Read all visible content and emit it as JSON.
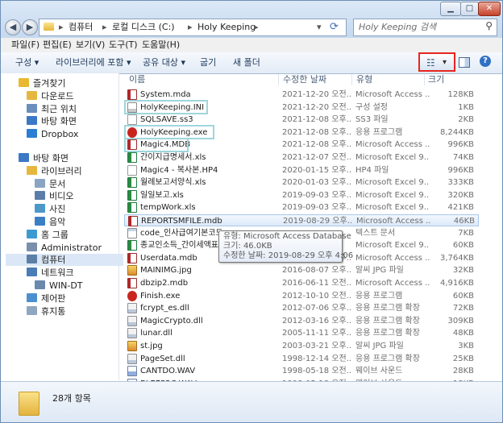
{
  "address": {
    "segments": [
      "컴퓨터",
      "로컬 디스크 (C:)",
      "Holy Keeping"
    ]
  },
  "search": {
    "placeholder": "Holy Keeping 검색"
  },
  "menu": [
    "파일(F)",
    "편집(E)",
    "보기(V)",
    "도구(T)",
    "도움말(H)"
  ],
  "commands": {
    "organize": "구성",
    "include_library": "라이브러리에 포함",
    "share": "공유 대상",
    "burn": "굽기",
    "new_folder": "새 폴더"
  },
  "sidebar": [
    {
      "label": "즐겨찾기",
      "icon": "star-icon",
      "indent": 0
    },
    {
      "label": "다운로드",
      "icon": "download-folder-icon",
      "indent": 1
    },
    {
      "label": "최근 위치",
      "icon": "recent-places-icon",
      "indent": 1
    },
    {
      "label": "바탕 화면",
      "icon": "desktop-icon",
      "indent": 1
    },
    {
      "label": "Dropbox",
      "icon": "dropbox-icon",
      "indent": 1
    },
    {
      "label": "바탕 화면",
      "icon": "desktop-icon",
      "indent": 0,
      "gap": true
    },
    {
      "label": "라이브러리",
      "icon": "library-icon",
      "indent": 1
    },
    {
      "label": "문서",
      "icon": "documents-icon",
      "indent": 2
    },
    {
      "label": "비디오",
      "icon": "video-icon",
      "indent": 2
    },
    {
      "label": "사진",
      "icon": "pictures-icon",
      "indent": 2
    },
    {
      "label": "음악",
      "icon": "music-icon",
      "indent": 2
    },
    {
      "label": "홈 그룹",
      "icon": "homegroup-icon",
      "indent": 1
    },
    {
      "label": "Administrator",
      "icon": "user-icon",
      "indent": 1
    },
    {
      "label": "컴퓨터",
      "icon": "computer-icon",
      "indent": 1,
      "selected": true
    },
    {
      "label": "네트워크",
      "icon": "network-icon",
      "indent": 1
    },
    {
      "label": "WIN-DT",
      "icon": "pc-icon",
      "indent": 2
    },
    {
      "label": "제어판",
      "icon": "control-panel-icon",
      "indent": 1
    },
    {
      "label": "휴지통",
      "icon": "recycle-bin-icon",
      "indent": 1
    }
  ],
  "columns": {
    "name": "이름",
    "date": "수정한 날짜",
    "type": "유형",
    "size": "크기"
  },
  "files": [
    {
      "name": "System.mda",
      "date": "2021-12-20 오전...",
      "type": "Microsoft Access ...",
      "size": "128KB",
      "icon": "access-file-icon"
    },
    {
      "name": "HolyKeeping.INI",
      "date": "2021-12-20 오전...",
      "type": "구성 설정",
      "size": "1KB",
      "icon": "ini-file-icon"
    },
    {
      "name": "SQLSAVE.ss3",
      "date": "2021-12-08 오후...",
      "type": "SS3 파일",
      "size": "2KB",
      "icon": "generic-file-icon"
    },
    {
      "name": "HolyKeeping.exe",
      "date": "2021-12-08 오후...",
      "type": "응용 프로그램",
      "size": "8,244KB",
      "icon": "app-exe-icon"
    },
    {
      "name": "Magic4.MDB",
      "date": "2021-12-08 오후...",
      "type": "Microsoft Access ...",
      "size": "996KB",
      "icon": "access-file-icon"
    },
    {
      "name": "간이지급명세서.xls",
      "date": "2021-12-07 오전...",
      "type": "Microsoft Excel 9...",
      "size": "74KB",
      "icon": "excel-file-icon"
    },
    {
      "name": "Magic4 - 복사본.HP4",
      "date": "2020-01-15 오후...",
      "type": "HP4 파일",
      "size": "996KB",
      "icon": "generic-file-icon"
    },
    {
      "name": "월례보고서양식.xls",
      "date": "2020-01-03 오후...",
      "type": "Microsoft Excel 9...",
      "size": "333KB",
      "icon": "excel-file-icon"
    },
    {
      "name": "일일보고.xls",
      "date": "2019-09-03 오후...",
      "type": "Microsoft Excel 9...",
      "size": "320KB",
      "icon": "excel-file-icon"
    },
    {
      "name": "tempWork.xls",
      "date": "2019-09-03 오후...",
      "type": "Microsoft Excel 9...",
      "size": "421KB",
      "icon": "excel-file-icon"
    },
    {
      "name": "REPORTSMFILE.mdb",
      "date": "2019-08-29 오후...",
      "type": "Microsoft Access ...",
      "size": "46KB",
      "icon": "access-file-icon",
      "selected": true
    },
    {
      "name": "code_인사급여기본코드",
      "date": "",
      "type": "텍스트 문서",
      "size": "7KB",
      "icon": "text-file-icon"
    },
    {
      "name": "종교인소득_간이세액표",
      "date": "",
      "type": "Microsoft Excel 9...",
      "size": "60KB",
      "icon": "excel-file-icon"
    },
    {
      "name": "Userdata.mdb",
      "date": "2019-08-29 오후...",
      "type": "Microsoft Access ...",
      "size": "3,764KB",
      "icon": "access-file-icon"
    },
    {
      "name": "MAINIMG.jpg",
      "date": "2016-08-07 오후...",
      "type": "알씨 JPG 파일",
      "size": "32KB",
      "icon": "image-file-icon"
    },
    {
      "name": "dbzip2.mdb",
      "date": "2016-06-11 오전...",
      "type": "Microsoft Access ...",
      "size": "4,916KB",
      "icon": "access-file-icon"
    },
    {
      "name": "Finish.exe",
      "date": "2012-10-10 오전...",
      "type": "응용 프로그램",
      "size": "60KB",
      "icon": "app-exe-icon"
    },
    {
      "name": "fcrypt_es.dll",
      "date": "2012-07-06 오후...",
      "type": "응용 프로그램 확장",
      "size": "72KB",
      "icon": "dll-file-icon"
    },
    {
      "name": "MagicCrypto.dll",
      "date": "2012-03-16 오후...",
      "type": "응용 프로그램 확장",
      "size": "309KB",
      "icon": "dll-file-icon"
    },
    {
      "name": "lunar.dll",
      "date": "2005-11-11 오후...",
      "type": "응용 프로그램 확장",
      "size": "48KB",
      "icon": "dll-file-icon"
    },
    {
      "name": "st.jpg",
      "date": "2003-03-21 오후...",
      "type": "알씨 JPG 파일",
      "size": "3KB",
      "icon": "image-file-icon"
    },
    {
      "name": "PageSet.dll",
      "date": "1998-12-14 오전...",
      "type": "응용 프로그램 확장",
      "size": "25KB",
      "icon": "dll-file-icon"
    },
    {
      "name": "CANTDO.WAV",
      "date": "1998-05-18 오전...",
      "type": "웨이브 사운드",
      "size": "28KB",
      "icon": "audio-file-icon"
    },
    {
      "name": "BLEEP3C.WAV",
      "date": "1998-05-18 오전...",
      "type": "웨이브 사운드",
      "size": "18KB",
      "icon": "audio-file-icon"
    }
  ],
  "tooltip": {
    "type_line": "유형: Microsoft Access Database",
    "size_line": "크기: 46.0KB",
    "date_line": "수정한 날짜: 2019-08-29 오후 4:06"
  },
  "status": {
    "item_count": "28개 항목"
  },
  "colors": {
    "highlight_box": "#9ed6dd",
    "view_button_outline": "#e8251f"
  }
}
